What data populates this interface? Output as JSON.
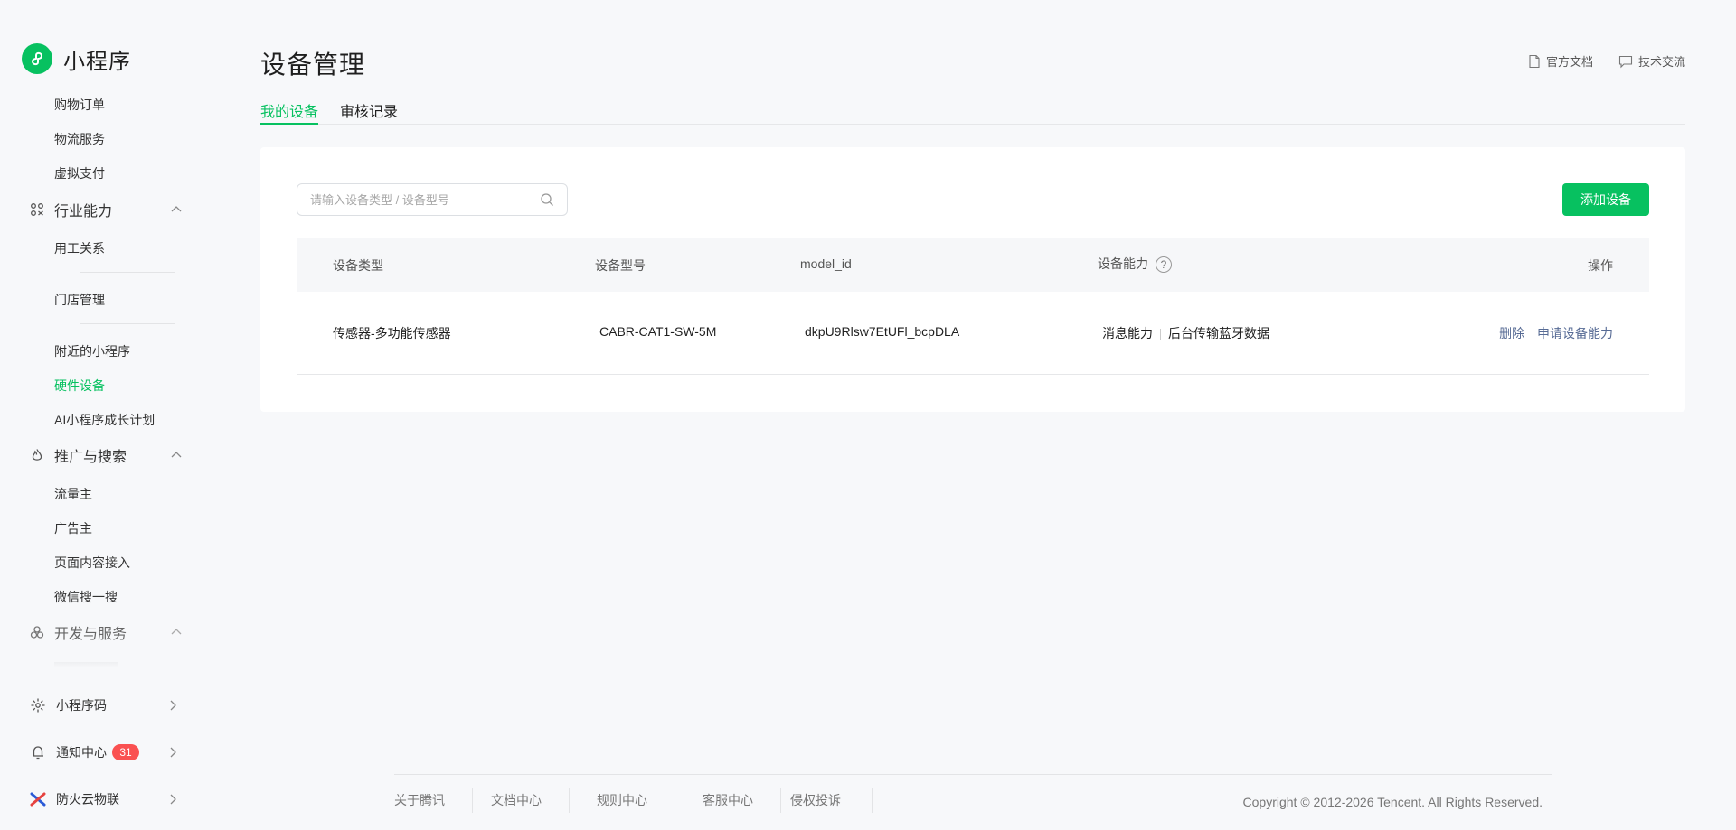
{
  "brand": {
    "name": "小程序"
  },
  "sidebar": {
    "items_top": [
      "购物订单",
      "物流服务",
      "虚拟支付"
    ],
    "groups": [
      {
        "label": "行业能力",
        "icon": "industry-icon",
        "expanded": true
      },
      {
        "label": "推广与搜索",
        "icon": "fire-icon",
        "expanded": true
      },
      {
        "label": "开发与服务",
        "icon": "dev-icon",
        "expanded": true
      }
    ],
    "industry_items": [
      "用工关系",
      "门店管理",
      "附近的小程序",
      "硬件设备",
      "AI小程序成长计划"
    ],
    "promo_items": [
      "流量主",
      "广告主",
      "页面内容接入",
      "微信搜一搜"
    ],
    "bottom": [
      {
        "label": "小程序码",
        "icon": "qrcode-icon"
      },
      {
        "label": "通知中心",
        "icon": "bell-icon",
        "badge": "31"
      },
      {
        "label": "防火云物联",
        "icon": "app-logo-icon"
      }
    ],
    "active_item": "硬件设备"
  },
  "page": {
    "title": "设备管理",
    "links": {
      "docs": "官方文档",
      "community": "技术交流"
    },
    "tabs": [
      {
        "label": "我的设备",
        "active": true
      },
      {
        "label": "审核记录",
        "active": false
      }
    ]
  },
  "toolbar": {
    "search_placeholder": "请输入设备类型 / 设备型号",
    "search_value": "",
    "add_button": "添加设备"
  },
  "table": {
    "columns": [
      "设备类型",
      "设备型号",
      "model_id",
      "设备能力",
      "操作"
    ],
    "rows": [
      {
        "type": "传感器-多功能传感器",
        "model": "CABR-CAT1-SW-5M",
        "model_id": "dkpU9Rlsw7EtUFl_bcpDLA",
        "capabilities": [
          "消息能力",
          "后台传输蓝牙数据"
        ],
        "actions": [
          "删除",
          "申请设备能力"
        ]
      }
    ]
  },
  "footer": {
    "links": [
      "关于腾讯",
      "文档中心",
      "规则中心",
      "客服中心",
      "侵权投诉"
    ],
    "copyright": "Copyright © 2012-2026 Tencent. All Rights Reserved."
  },
  "colors": {
    "accent": "#07c160",
    "link": "#576b95",
    "badge": "#fa5151",
    "background": "#f7f8fa"
  }
}
